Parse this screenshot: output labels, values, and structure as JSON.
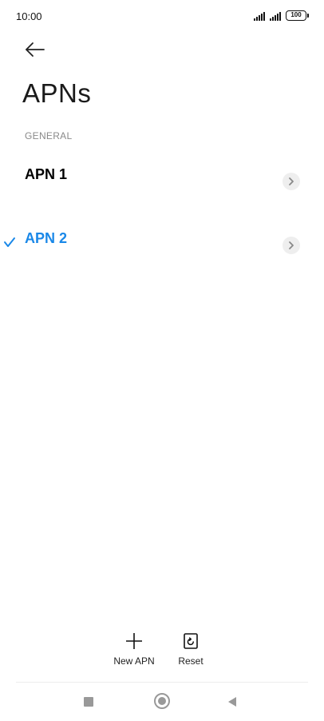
{
  "status_bar": {
    "time": "10:00",
    "battery": "100"
  },
  "header": {
    "back_icon": "arrow-left-icon",
    "title": "APNs"
  },
  "section": {
    "label": "GENERAL"
  },
  "apns": [
    {
      "name": "APN 1",
      "selected": false
    },
    {
      "name": "APN 2",
      "selected": true
    }
  ],
  "actions": {
    "new_apn_label": "New APN",
    "reset_label": "Reset"
  },
  "nav": {
    "recents_icon": "square-icon",
    "home_icon": "circle-icon",
    "back_icon": "triangle-left-icon"
  },
  "colors": {
    "accent": "#1a88e8",
    "text": "#000000",
    "secondary": "#8a8a8a"
  }
}
